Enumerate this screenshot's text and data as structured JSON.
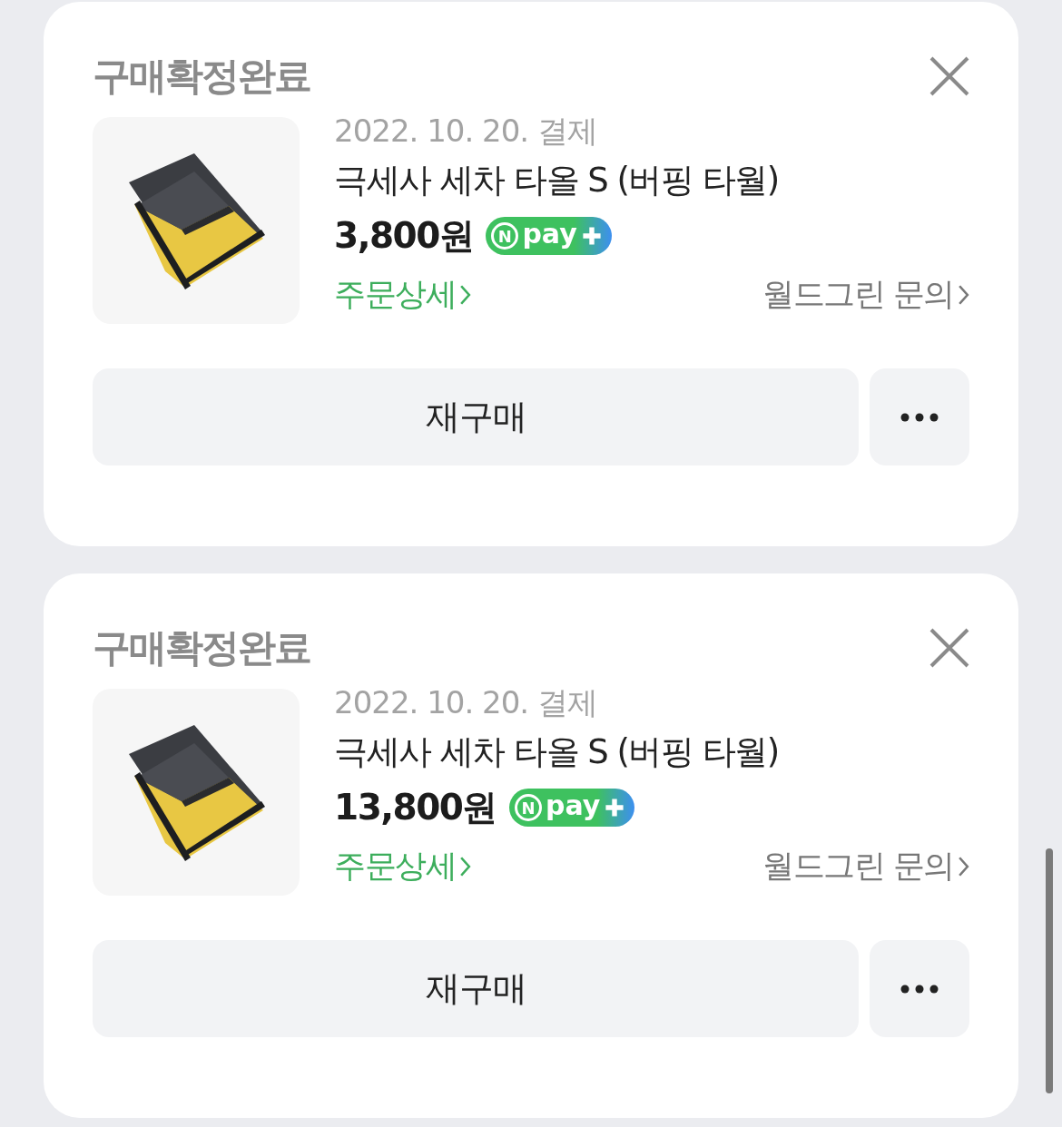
{
  "orders": [
    {
      "status": "구매확정완료",
      "date": "2022. 10. 20. 결제",
      "product": "극세사 세차 타올 S (버핑 타월)",
      "price": "3,800원",
      "badge": {
        "mark": "N",
        "text": "pay"
      },
      "detail_link": "주문상세",
      "seller_link": "월드그린 문의",
      "rebuy_button": "재구매"
    },
    {
      "status": "구매확정완료",
      "date": "2022. 10. 20. 결제",
      "product": "극세사 세차 타올 S (버핑 타월)",
      "price": "13,800원",
      "badge": {
        "mark": "N",
        "text": "pay"
      },
      "detail_link": "주문상세",
      "seller_link": "월드그린 문의",
      "rebuy_button": "재구매"
    }
  ]
}
